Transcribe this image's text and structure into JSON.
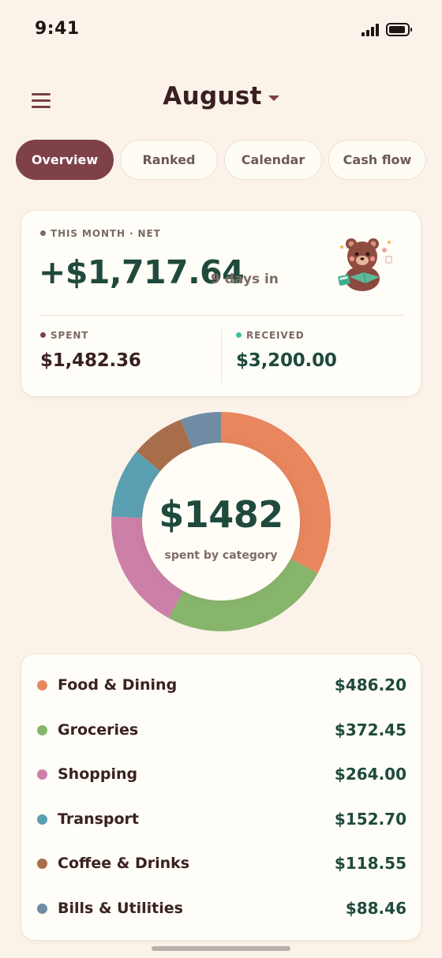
{
  "status_bar": {
    "time": "9:41"
  },
  "header": {
    "month": "August"
  },
  "tabs": [
    {
      "label": "Overview",
      "active": true
    },
    {
      "label": "Ranked",
      "active": false
    },
    {
      "label": "Calendar",
      "active": false
    },
    {
      "label": "Cash flow",
      "active": false
    }
  ],
  "summary": {
    "label": "THIS MONTH · NET",
    "net": "+$1,717.64",
    "days": "9 days in",
    "spent_label": "SPENT",
    "spent": "$1,482.36",
    "received_label": "RECEIVED",
    "received": "$3,200.00"
  },
  "donut": {
    "total": "$1482",
    "caption": "spent by category"
  },
  "categories": [
    {
      "name": "Food & Dining",
      "amount": "$486.20",
      "value": 486.2,
      "color": "#e8865e"
    },
    {
      "name": "Groceries",
      "amount": "$372.45",
      "value": 372.45,
      "color": "#86b56b"
    },
    {
      "name": "Shopping",
      "amount": "$264.00",
      "value": 264.0,
      "color": "#cc7fa7"
    },
    {
      "name": "Transport",
      "amount": "$152.70",
      "value": 152.7,
      "color": "#5b9fb2"
    },
    {
      "name": "Coffee & Drinks",
      "amount": "$118.55",
      "value": 118.55,
      "color": "#a86e4b"
    },
    {
      "name": "Bills & Utilities",
      "amount": "$88.46",
      "value": 88.46,
      "color": "#6f8ca4"
    }
  ],
  "colors": {
    "net_green": "#1f4a3d",
    "spent_dot": "#7e414a",
    "received_dot": "#3cbfa0",
    "accent": "#7e414a"
  },
  "icons": [
    "menu-icon",
    "chevron-down-icon",
    "signal-icon",
    "battery-icon",
    "bear-illustration"
  ]
}
